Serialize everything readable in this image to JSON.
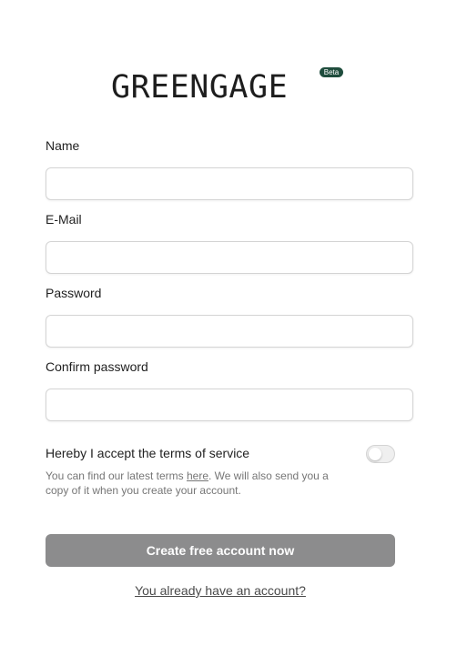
{
  "brand": {
    "name": "GREENGAGE",
    "badge": "Beta",
    "badge_color": "#1f4d3d"
  },
  "form": {
    "fields": [
      {
        "label": "Name",
        "value": "",
        "type": "text"
      },
      {
        "label": "E-Mail",
        "value": "",
        "type": "email"
      },
      {
        "label": "Password",
        "value": "",
        "type": "password"
      },
      {
        "label": "Confirm password",
        "value": "",
        "type": "password"
      }
    ],
    "terms": {
      "title": "Hereby I accept the terms of service",
      "desc_before": "You can find our latest terms ",
      "desc_link": "here",
      "desc_after": ". We will also send you a copy of it when you create your account.",
      "accepted": false
    },
    "submit_label": "Create free account now",
    "submit_color": "#8c8c8d",
    "login_link": "You already have an account?"
  }
}
